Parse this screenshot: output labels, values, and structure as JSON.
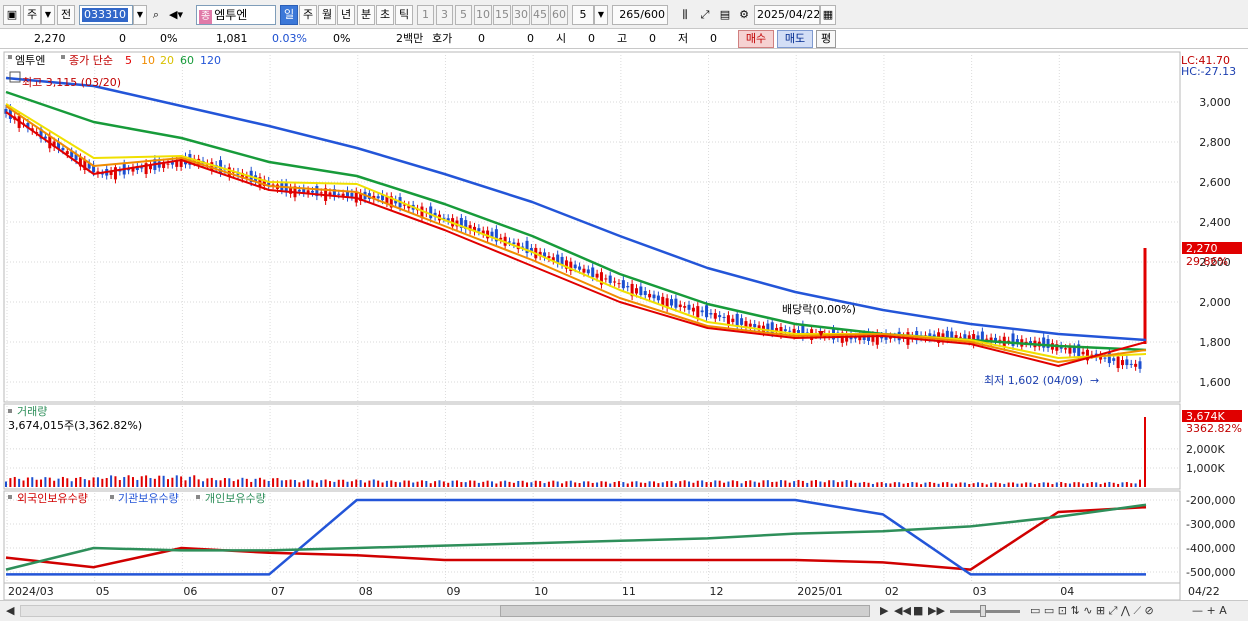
{
  "toolbar": {
    "type_label": "주",
    "prev_label": "전",
    "code": "033310",
    "stock_tag": "종",
    "stock_name": "엠투엔",
    "periods": [
      "일",
      "주",
      "월",
      "년",
      "분",
      "초",
      "틱"
    ],
    "active_period": "일",
    "intervals": [
      "1",
      "3",
      "5",
      "10",
      "15",
      "30",
      "45",
      "60"
    ],
    "interval_value": "5",
    "count_current": "265",
    "count_max": "/600",
    "date": "2025/04/22"
  },
  "infobar": {
    "price": "2,270",
    "change": "0",
    "change_pct": "0%",
    "volume": "1,081",
    "turnover": "0.03%",
    "vol_pct": "0%",
    "unit": "2백만",
    "quote_label": "호가",
    "q1": "0",
    "q2": "0",
    "open_label": "시",
    "open_val": "0",
    "high_label": "고",
    "high_val": "0",
    "low_label": "저",
    "low_val": "0",
    "buy_label": "매수",
    "sell_label": "매도",
    "avg_label": "평"
  },
  "colors": {
    "ma5": "#e00000",
    "ma10": "#f08c00",
    "ma20": "#f0e000",
    "ma60": "#179b3a",
    "ma120": "#2355d8",
    "up": "#e00000",
    "down": "#1c4fd0",
    "foreign": "#d00000",
    "institution": "#2355d8",
    "individual": "#2e8f5a"
  },
  "price_panel": {
    "legend_name": "엠투엔",
    "legend_label": "종가 단순",
    "ma_periods": [
      "5",
      "10",
      "20",
      "60",
      "120"
    ],
    "high_note": "최고 3,115 (03/20)",
    "low_note": "최저 1,602 (04/09)",
    "dividend_note": "배당락(0.00%)",
    "lc": "LC:41.70",
    "hc": "HC:-27.13",
    "current_price": "2,270",
    "current_pct": "29.86%",
    "y_ticks": [
      "3,000",
      "2,800",
      "2,600",
      "2,400",
      "2,200",
      "2,000",
      "1,800",
      "1,600"
    ]
  },
  "volume_panel": {
    "title": "거래량",
    "value_text": "3,674,015주(3,362.82%)",
    "current_label": "3,674K",
    "current_pct": "3362.82%",
    "y_ticks": [
      "2,000K",
      "1,000K"
    ]
  },
  "holding_panel": {
    "legend": [
      "외국인보유수량",
      "기관보유수량",
      "개인보유수량"
    ],
    "y_ticks": [
      "-200,000",
      "-300,000",
      "-400,000",
      "-500,000"
    ]
  },
  "x_axis": {
    "labels": [
      "2024/03",
      "05",
      "06",
      "07",
      "08",
      "09",
      "10",
      "11",
      "12",
      "2025/01",
      "02",
      "03",
      "04"
    ],
    "end_label": "04/22"
  },
  "chart_data": [
    {
      "type": "line",
      "title": "",
      "ylabel": "",
      "ylim": [
        1500,
        3200
      ],
      "x": [
        "2024/03",
        "05",
        "06",
        "07",
        "08",
        "09",
        "10",
        "11",
        "12",
        "2025/01",
        "02",
        "03",
        "04",
        "04/22"
      ],
      "series": [
        {
          "name": "5",
          "values": [
            2950,
            2640,
            2710,
            2560,
            2520,
            2360,
            2180,
            2000,
            1870,
            1820,
            1830,
            1790,
            1680,
            1800
          ]
        },
        {
          "name": "10",
          "values": [
            2980,
            2680,
            2720,
            2580,
            2550,
            2380,
            2210,
            2020,
            1880,
            1830,
            1840,
            1800,
            1700,
            1760
          ]
        },
        {
          "name": "20",
          "values": [
            2990,
            2720,
            2730,
            2600,
            2590,
            2410,
            2250,
            2060,
            1900,
            1840,
            1840,
            1810,
            1720,
            1740
          ]
        },
        {
          "name": "60",
          "values": [
            3050,
            2900,
            2820,
            2700,
            2630,
            2490,
            2330,
            2140,
            1990,
            1890,
            1840,
            1810,
            1780,
            1760
          ]
        },
        {
          "name": "120",
          "values": [
            3120,
            3080,
            2980,
            2880,
            2770,
            2640,
            2500,
            2330,
            2170,
            2050,
            1960,
            1890,
            1840,
            1810
          ]
        }
      ],
      "close": {
        "last": 2270,
        "change_pct": 29.86
      }
    },
    {
      "type": "bar",
      "title": "거래량",
      "ylim": [
        0,
        3674015
      ],
      "x": [
        "2024/03",
        "05",
        "06",
        "07",
        "08",
        "09",
        "10",
        "11",
        "12",
        "2025/01",
        "02",
        "03",
        "04",
        "04/22"
      ],
      "values": [
        60000,
        70000,
        55000,
        45000,
        40000,
        38000,
        35000,
        40000,
        42000,
        30000,
        28000,
        30000,
        45000,
        3674015
      ]
    },
    {
      "type": "line",
      "title": "",
      "ylim": [
        -520000,
        -190000
      ],
      "x": [
        "2024/03",
        "05",
        "06",
        "07",
        "08",
        "09",
        "10",
        "11",
        "12",
        "2025/01",
        "02",
        "03",
        "04",
        "04/22"
      ],
      "series": [
        {
          "name": "외국인보유수량",
          "values": [
            -440000,
            -480000,
            -400000,
            -420000,
            -430000,
            -450000,
            -450000,
            -450000,
            -450000,
            -450000,
            -460000,
            -490000,
            -250000,
            -230000
          ]
        },
        {
          "name": "기관보유수량",
          "values": [
            -510000,
            -510000,
            -510000,
            -510000,
            -200000,
            -200000,
            -200000,
            -200000,
            -200000,
            -200000,
            -260000,
            -510000,
            -510000,
            -510000
          ]
        },
        {
          "name": "개인보유수량",
          "values": [
            -490000,
            -400000,
            -410000,
            -410000,
            -400000,
            -390000,
            -380000,
            -370000,
            -360000,
            -340000,
            -330000,
            -310000,
            -270000,
            -220000
          ]
        }
      ]
    }
  ],
  "bottombar": {
    "controls": [
      "▶",
      "◀◀",
      "■",
      "▶▶"
    ],
    "tools": "— + A"
  }
}
